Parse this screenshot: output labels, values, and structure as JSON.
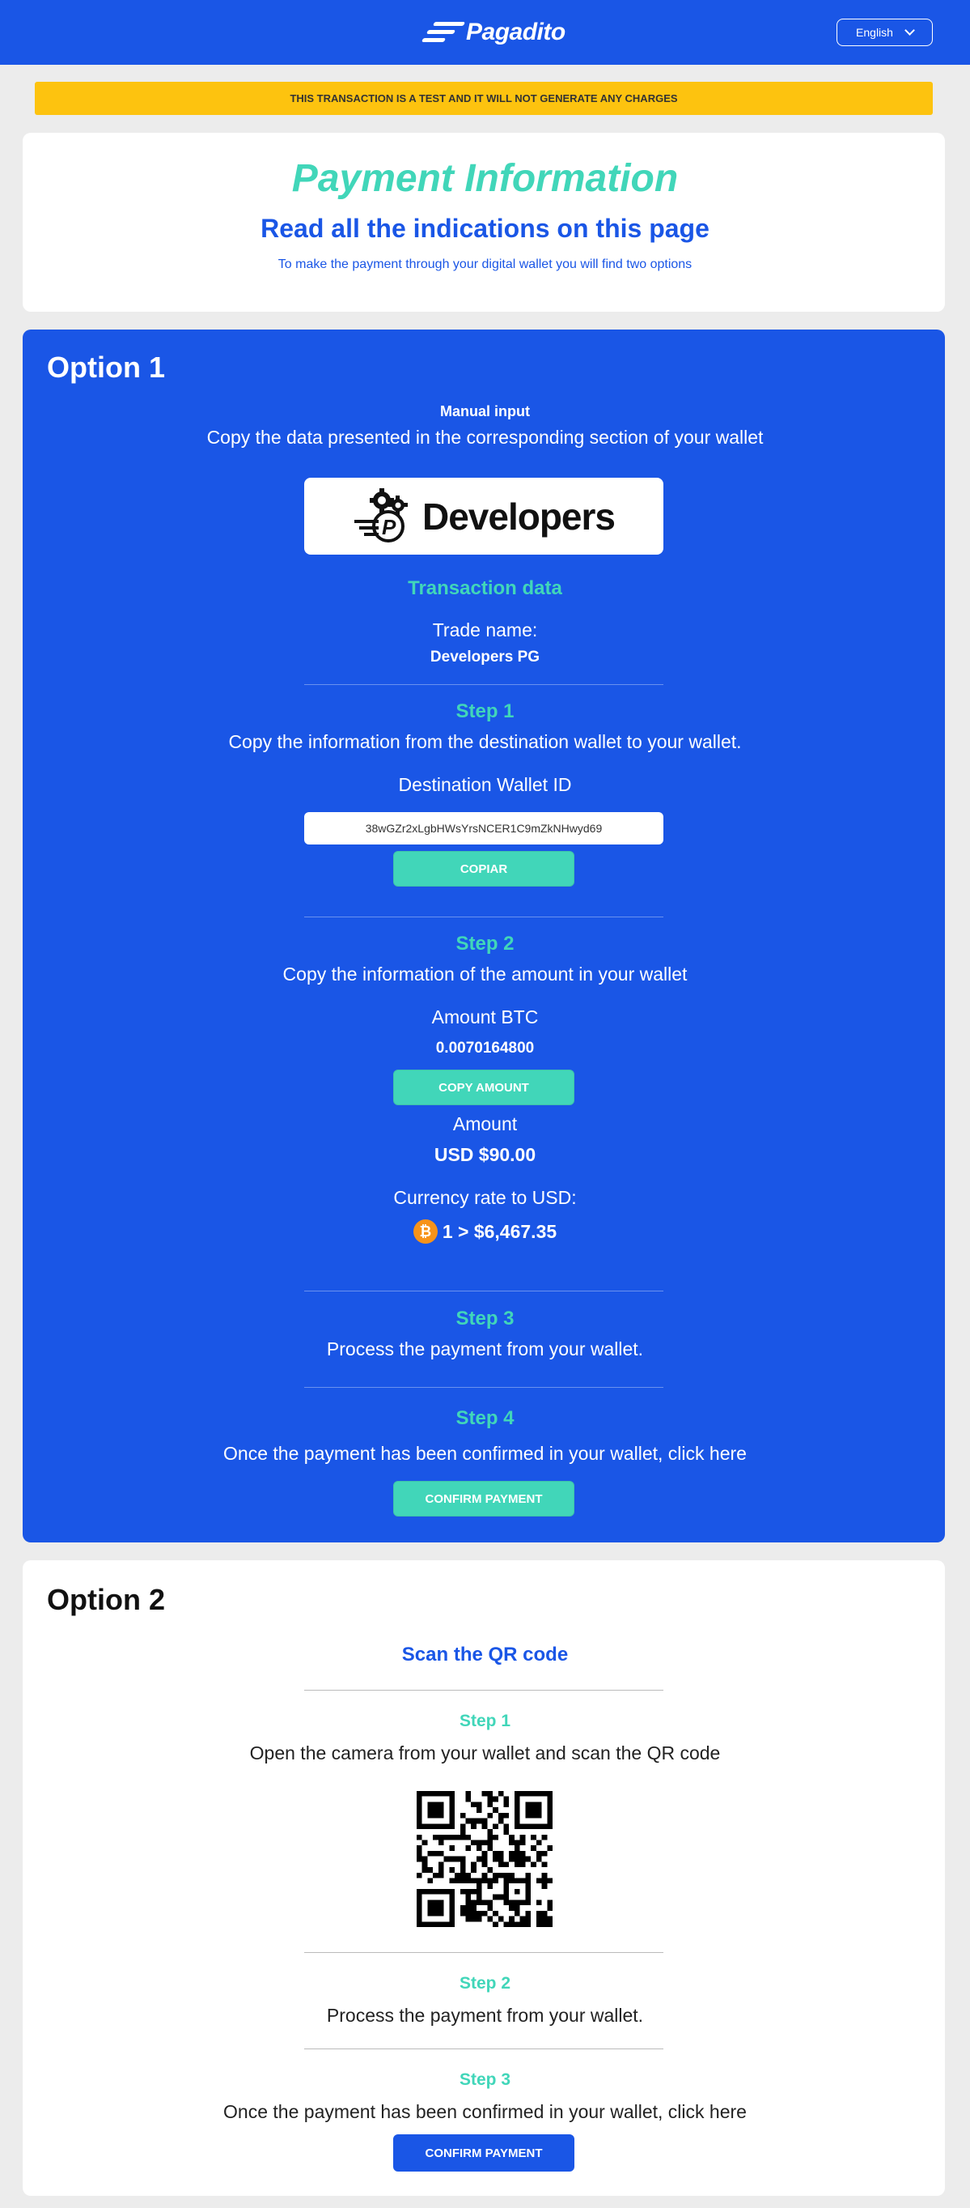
{
  "header": {
    "brand": "Pagadito",
    "language": "English"
  },
  "banner": "THIS TRANSACTION IS A TEST AND IT WILL NOT GENERATE ANY CHARGES",
  "intro": {
    "title": "Payment Information",
    "subtitle": "Read all the indications on this page",
    "note": "To make the payment through your digital wallet you will find two options"
  },
  "option1": {
    "heading": "Option 1",
    "manual_label": "Manual input",
    "manual_text": "Copy the data presented in the corresponding section of your wallet",
    "merchant_logo": "Developers",
    "transaction_heading": "Transaction data",
    "trade_name_label": "Trade name:",
    "trade_name_value": "Developers PG",
    "step1": {
      "title": "Step 1",
      "text": "Copy the information from the destination wallet to your wallet.",
      "wallet_label": "Destination Wallet ID",
      "wallet_id": "38wGZr2xLgbHWsYrsNCER1C9mZkNHwyd69",
      "copy_button": "COPIAR"
    },
    "step2": {
      "title": "Step 2",
      "text": "Copy the information of the amount in your wallet",
      "amount_btc_label": "Amount BTC",
      "amount_btc_value": "0.0070164800",
      "copy_amount_button": "COPY AMOUNT",
      "amount_label": "Amount",
      "amount_value": "USD $90.00",
      "rate_label": "Currency rate to USD:",
      "rate_value": "1 > $6,467.35"
    },
    "step3": {
      "title": "Step 3",
      "text": "Process the payment from your wallet."
    },
    "step4": {
      "title": "Step 4",
      "text": "Once the payment has been confirmed in your wallet, click here",
      "confirm_button": "CONFIRM PAYMENT"
    }
  },
  "option2": {
    "heading": "Option 2",
    "scan_title": "Scan the QR code",
    "step1": {
      "title": "Step 1",
      "text": "Open the camera from your wallet and scan the QR code"
    },
    "step2": {
      "title": "Step 2",
      "text": "Process the payment from your wallet."
    },
    "step3": {
      "title": "Step 3",
      "text": "Once the payment has been confirmed in your wallet, click here",
      "confirm_button": "CONFIRM PAYMENT"
    }
  },
  "colors": {
    "primary_blue": "#1a56e6",
    "teal": "#41d6b9",
    "warning_yellow": "#fdc30f",
    "bitcoin_orange": "#f7931a"
  },
  "icons": [
    "chevron-down-icon",
    "bitcoin-icon",
    "gears-icon",
    "qr-code-icon"
  ]
}
